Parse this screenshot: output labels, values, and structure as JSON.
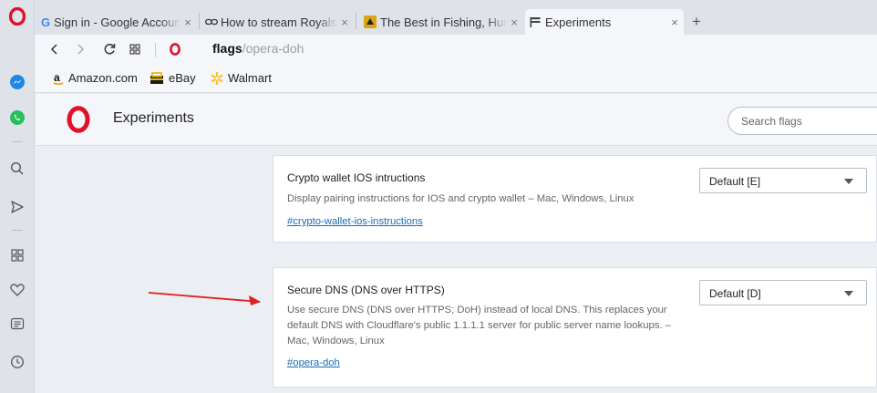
{
  "tabs": [
    {
      "label": "Sign in - Google Accounts"
    },
    {
      "label": "How to stream Royals"
    },
    {
      "label": "The Best in Fishing, Hunting"
    },
    {
      "label": "Experiments"
    }
  ],
  "new_tab_glyph": "+",
  "close_glyph": "×",
  "address": {
    "host": "flags",
    "path": "/opera-doh"
  },
  "bookmarks": [
    {
      "label": "Amazon.com"
    },
    {
      "label": "eBay"
    },
    {
      "label": "Walmart"
    }
  ],
  "page": {
    "title": "Experiments",
    "search_placeholder": "Search flags"
  },
  "flags": [
    {
      "name": "Crypto wallet IOS intructions",
      "description": "Display pairing instructions for IOS and crypto wallet – Mac, Windows, Linux",
      "link": "#crypto-wallet-ios-instructions",
      "selected": "Default [E]"
    },
    {
      "name": "Secure DNS (DNS over HTTPS)",
      "description": "Use secure DNS (DNS over HTTPS; DoH) instead of local DNS. This replaces your default DNS with Cloudflare's public 1.1.1.1 server for public server name lookups. – Mac, Windows, Linux",
      "link": "#opera-doh",
      "selected": "Default [D]"
    }
  ],
  "colors": {
    "opera_red": "#e0112b",
    "annotation_arrow": "#e02020",
    "link": "#1a6bb8"
  },
  "icons": [
    "opera-logo-icon",
    "messenger-icon",
    "whatsapp-icon",
    "search-icon",
    "send-icon",
    "speed-dial-icon",
    "heart-icon",
    "news-icon",
    "history-icon",
    "google-g-icon",
    "link-icon",
    "fishing-icon",
    "flag-icon",
    "back-icon",
    "forward-icon",
    "reload-icon",
    "grid-icon",
    "amazon-icon",
    "ebay-icon",
    "walmart-icon",
    "chevron-down-icon"
  ]
}
